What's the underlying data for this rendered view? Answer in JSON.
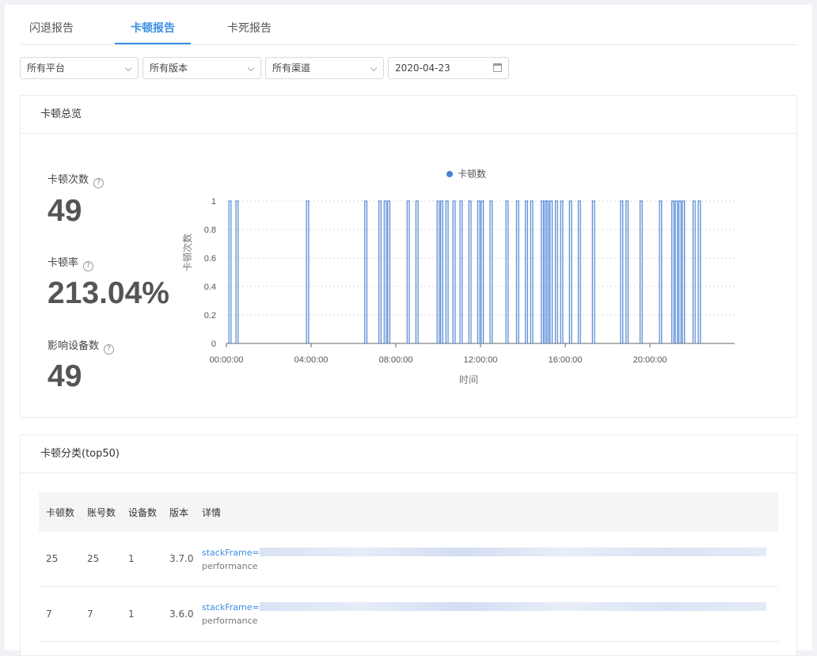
{
  "tabs": [
    {
      "label": "闪退报告",
      "active": false
    },
    {
      "label": "卡顿报告",
      "active": true
    },
    {
      "label": "卡死报告",
      "active": false
    }
  ],
  "filters": {
    "platform": "所有平台",
    "version": "所有版本",
    "channel": "所有渠道",
    "date": "2020-04-23"
  },
  "overview": {
    "title": "卡顿总览",
    "stats": [
      {
        "label": "卡顿次数",
        "value": "49"
      },
      {
        "label": "卡顿率",
        "value": "213.04%"
      },
      {
        "label": "影响设备数",
        "value": "49"
      }
    ]
  },
  "chart_data": {
    "type": "line",
    "legend": [
      "卡顿数"
    ],
    "xlabel": "时间",
    "ylabel": "卡顿次数",
    "ylim": [
      0,
      1
    ],
    "yticks": [
      "0",
      "0.2",
      "0.4",
      "0.6",
      "0.8",
      "1"
    ],
    "xlim_hours": [
      0,
      24
    ],
    "xticks": [
      "00:00:00",
      "04:00:00",
      "08:00:00",
      "12:00:00",
      "16:00:00",
      "20:00:00"
    ],
    "series": [
      {
        "name": "卡顿数",
        "color": "#5b8ed8",
        "event_times": [
          "00:10",
          "00:30",
          "03:50",
          "06:35",
          "07:15",
          "07:30",
          "07:40",
          "08:35",
          "09:00",
          "10:00",
          "10:10",
          "10:25",
          "10:45",
          "11:05",
          "11:30",
          "11:55",
          "12:05",
          "12:30",
          "13:15",
          "13:45",
          "14:10",
          "14:25",
          "14:55",
          "15:05",
          "15:10",
          "15:20",
          "15:35",
          "15:50",
          "16:15",
          "16:40",
          "17:20",
          "18:40",
          "18:55",
          "19:35",
          "20:30",
          "21:05",
          "21:15",
          "21:25",
          "21:35",
          "22:05",
          "22:20"
        ],
        "value": 1
      }
    ]
  },
  "category": {
    "title": "卡顿分类(top50)",
    "columns": [
      "卡顿数",
      "账号数",
      "设备数",
      "版本",
      "详情"
    ],
    "rows": [
      {
        "count": "25",
        "accounts": "25",
        "devices": "1",
        "version": "3.7.0",
        "detail_link": "stackFrame=",
        "detail_sub": "performance"
      },
      {
        "count": "7",
        "accounts": "7",
        "devices": "1",
        "version": "3.6.0",
        "detail_link": "stackFrame=",
        "detail_sub": "performance"
      }
    ]
  }
}
